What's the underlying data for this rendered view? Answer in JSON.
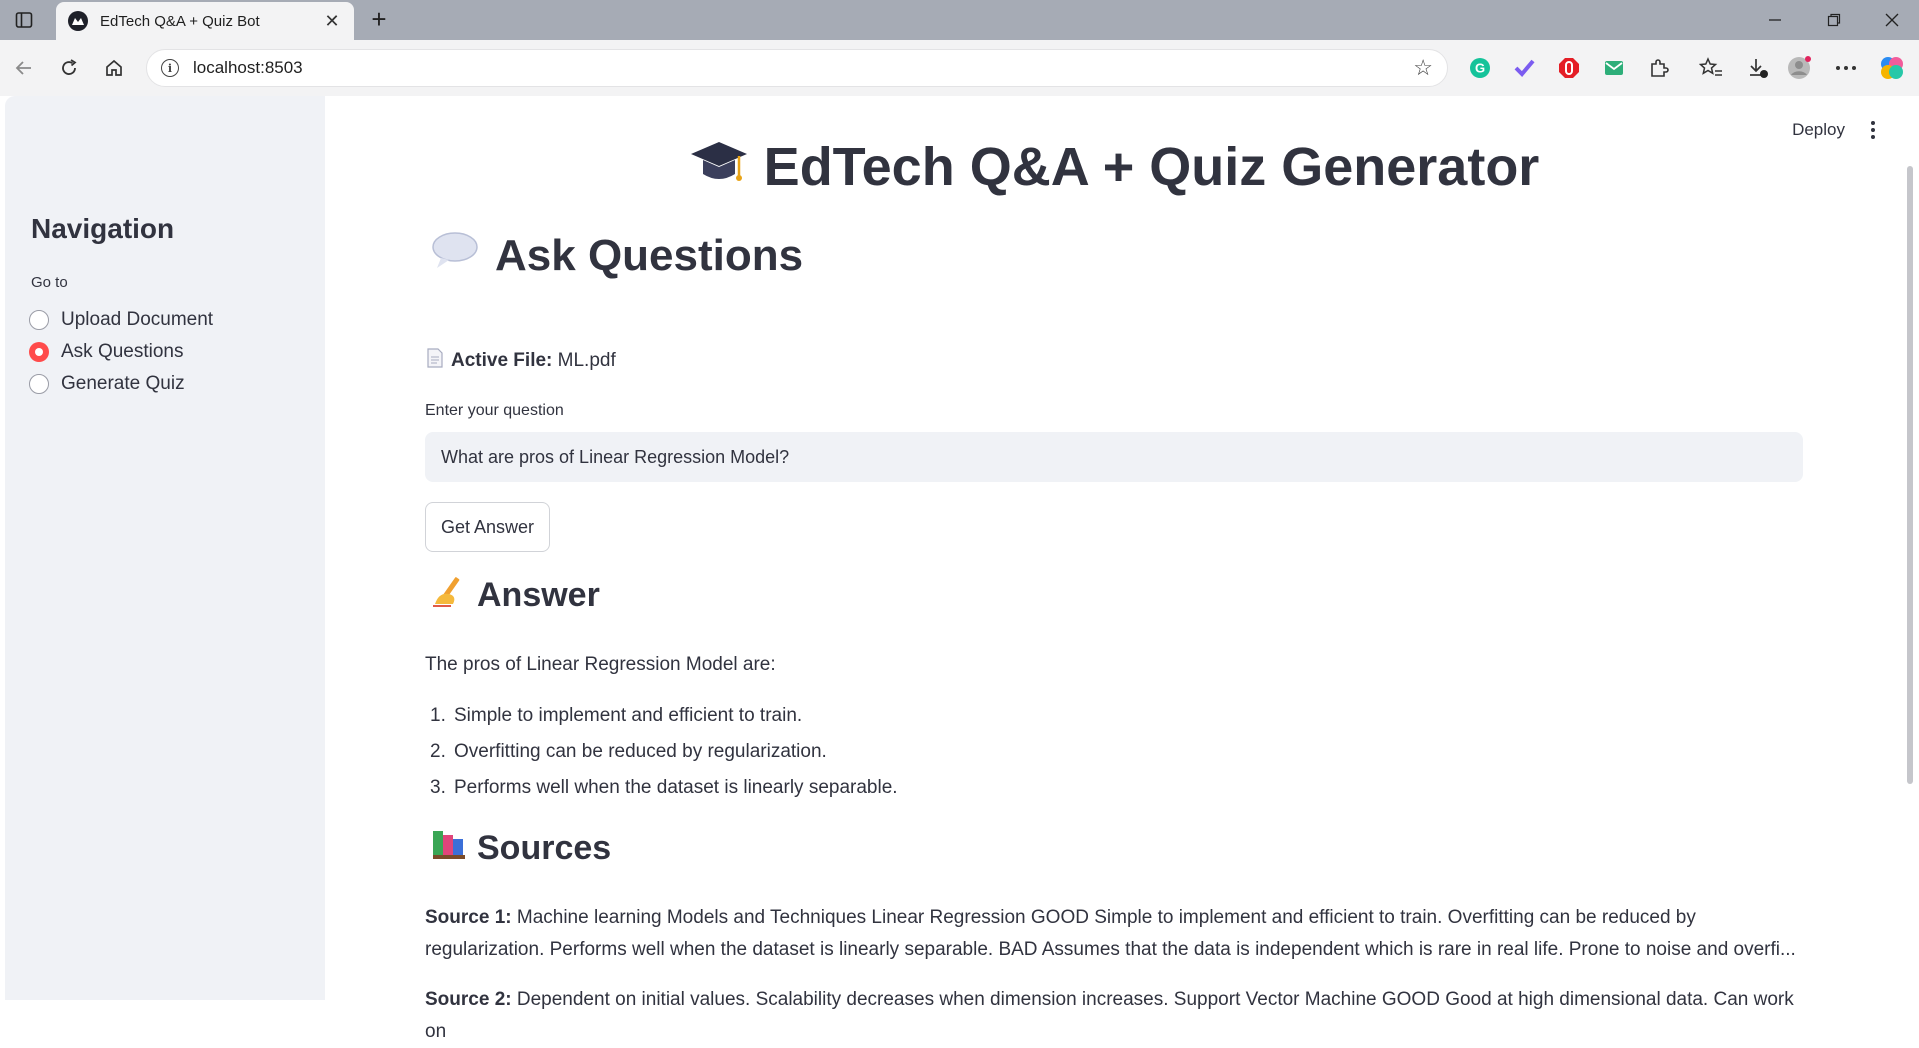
{
  "browser": {
    "tab_title": "EdTech Q&A + Quiz Bot",
    "url": "localhost:8503"
  },
  "sidebar": {
    "heading": "Navigation",
    "goto_label": "Go to",
    "options": [
      {
        "label": "Upload Document",
        "selected": false
      },
      {
        "label": "Ask Questions",
        "selected": true
      },
      {
        "label": "Generate Quiz",
        "selected": false
      }
    ]
  },
  "header": {
    "deploy_label": "Deploy"
  },
  "main": {
    "title": "EdTech Q&A + Quiz Generator",
    "section_title": "Ask Questions",
    "active_file_label": "Active File:",
    "active_file_name": "ML.pdf",
    "input_label": "Enter your question",
    "question_value": "What are pros of Linear Regression Model?",
    "button_label": "Get Answer",
    "answer_heading": "Answer",
    "answer_intro": "The pros of Linear Regression Model are:",
    "answer_items": [
      "Simple to implement and efficient to train.",
      "Overfitting can be reduced by regularization.",
      "Performs well when the dataset is linearly separable."
    ],
    "sources_heading": "Sources",
    "sources": [
      {
        "label": "Source 1:",
        "text": "Machine learning Models and Techniques Linear Regression GOOD Simple to implement and efficient to train. Overfitting can be reduced by regularization. Performs well when the dataset is linearly separable. BAD Assumes that the data is independent which is rare in real life. Prone to noise and overfi..."
      },
      {
        "label": "Source 2:",
        "text": "Dependent on initial values. Scalability decreases when dimension increases. Support Vector Machine GOOD Good at high dimensional data. Can work on"
      }
    ]
  },
  "colors": {
    "accent": "#ff4b4b",
    "sidebar_bg": "#f0f2f6",
    "text": "#31333f",
    "chrome_tabstrip": "#a6abb5"
  }
}
